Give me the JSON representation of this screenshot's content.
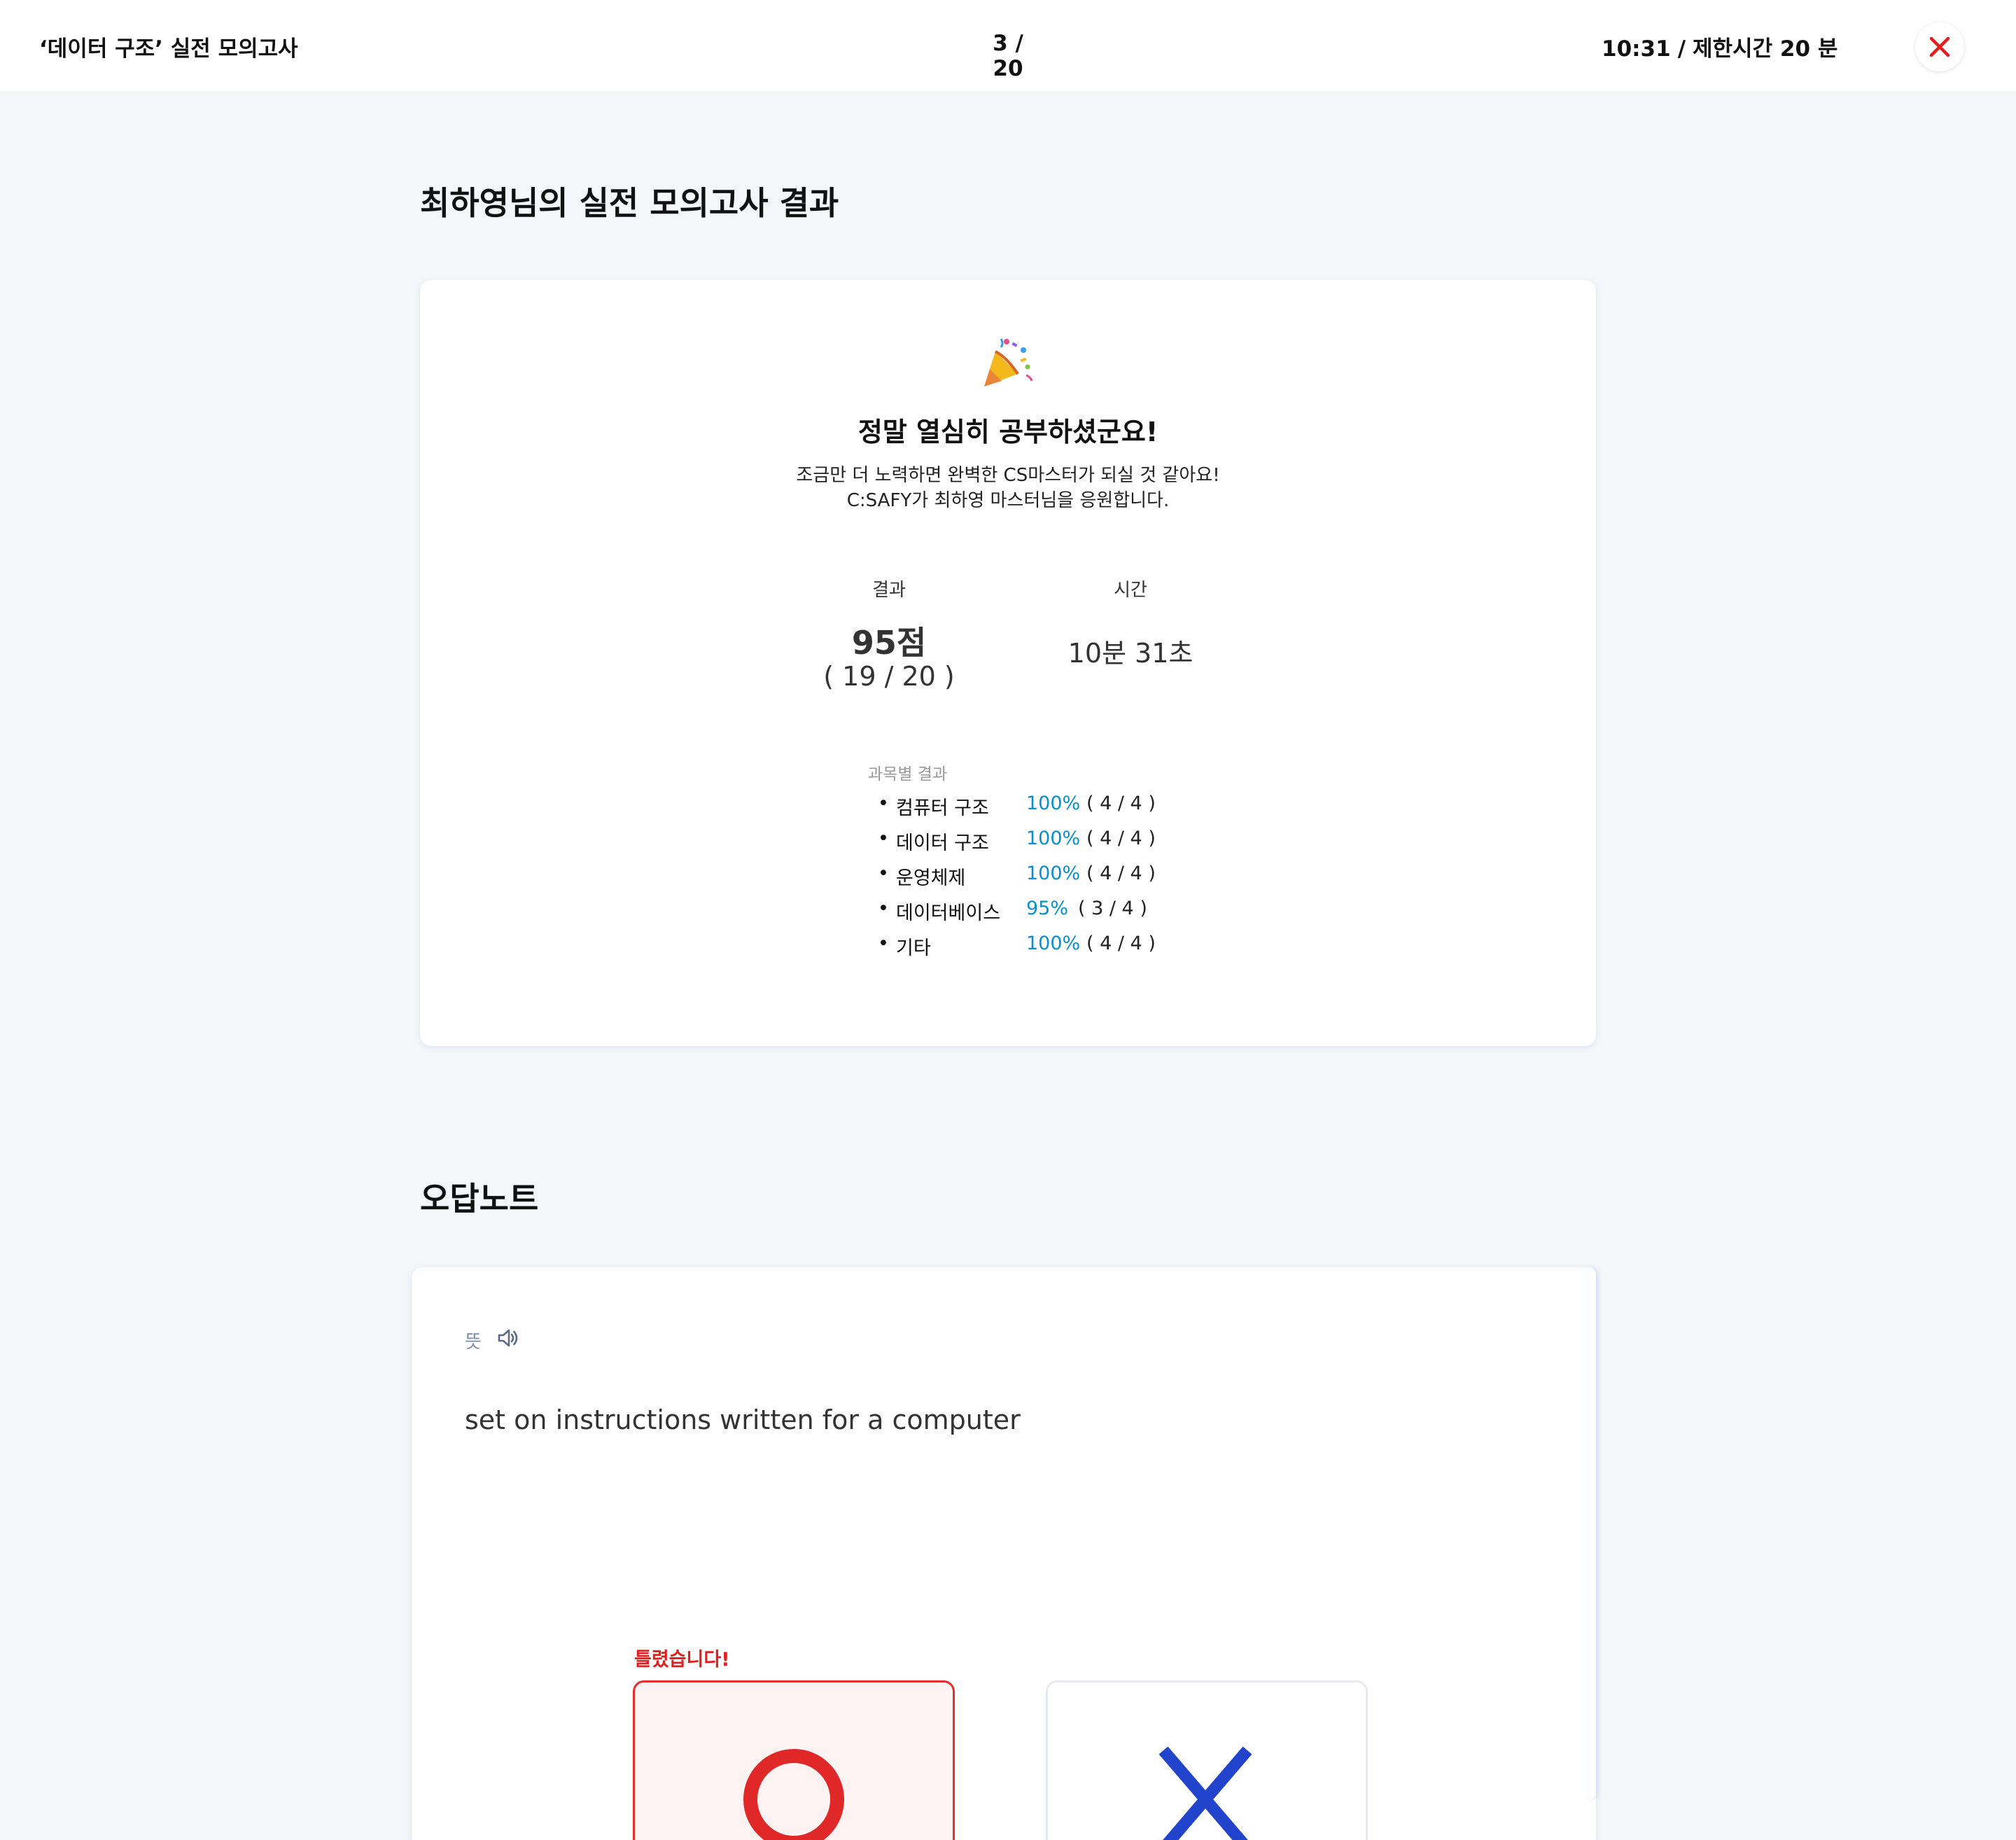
{
  "header": {
    "exam_title": "‘데이터 구조’ 실전 모의고사",
    "progress": "3 / 20",
    "elapsed": "10:31",
    "separator": "/",
    "limit": "제한시간 20 분"
  },
  "result": {
    "section_title": "최하영님의 실전 모의고사 결과",
    "headline": "정말 열심히 공부하셨군요!",
    "message_line1": "조금만 더 노력하면 완벽한 CS마스터가 되실 것 같아요!",
    "message_line2": "C:SAFY가 최하영 마스터님을 응원합니다.",
    "score_label": "결과",
    "score": "95점",
    "score_fraction": "( 19 / 20 )",
    "time_label": "시간",
    "time": "10분 31초",
    "subjects_heading": "과목별 결과",
    "subjects": [
      {
        "name": "컴퓨터 구조",
        "percent": "100%",
        "count": "( 4 / 4 )"
      },
      {
        "name": "데이터 구조",
        "percent": "100%",
        "count": "( 4 / 4 )"
      },
      {
        "name": "운영체제",
        "percent": "100%",
        "count": "( 4 / 4 )"
      },
      {
        "name": "데이터베이스",
        "percent": "95%",
        "count": "( 3 / 4 )"
      },
      {
        "name": "기타",
        "percent": "100%",
        "count": "( 4 / 4 )"
      }
    ]
  },
  "note": {
    "section_title": "오답노트",
    "meaning_label": "뜻",
    "question": "set on instructions written for a computer",
    "wrong_label": "틀렸습니다!",
    "choice_o": "O",
    "choice_x": "X"
  },
  "colors": {
    "accent_blue": "#0a8fcc",
    "wrong_red": "#e02020",
    "x_blue": "#2244cc",
    "background": "#f4f6f9"
  },
  "icons": [
    "close-icon",
    "party-popper-icon",
    "speaker-icon"
  ]
}
